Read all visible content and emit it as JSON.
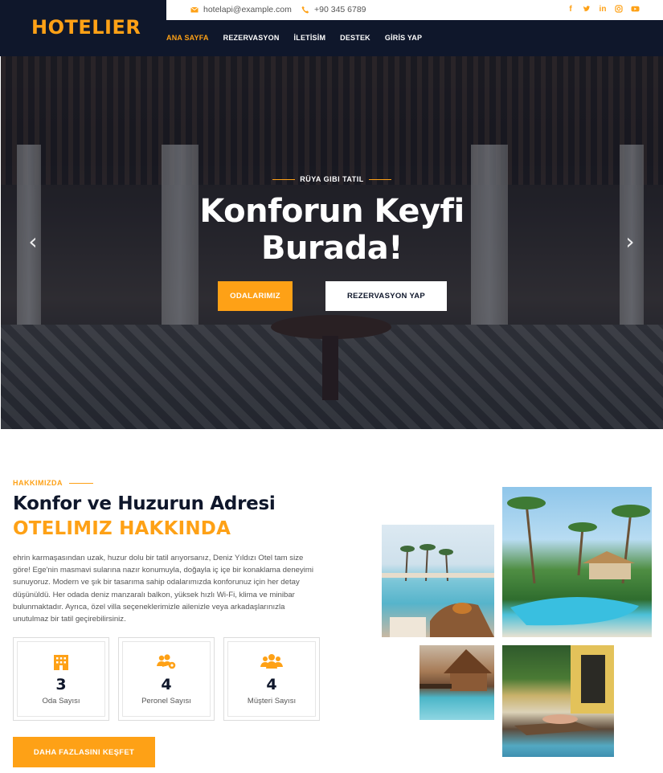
{
  "brand": {
    "logo": "HOTELIER",
    "accent": "#fea116",
    "dark": "#0f172b"
  },
  "topbar": {
    "email": "hotelapi@example.com",
    "phone": "+90 345 6789",
    "socials": [
      "facebook-icon",
      "twitter-icon",
      "linkedin-icon",
      "instagram-icon",
      "youtube-icon"
    ]
  },
  "nav": {
    "items": [
      "ANA SAYFA",
      "REZERVASYON",
      "İLETİSİM",
      "DESTEK",
      "GİRİS YAP"
    ]
  },
  "hero": {
    "kicker": "RÜYA GIBI TATIL",
    "title_line1": "Konforun Keyfi",
    "title_line2": "Burada!",
    "btn_rooms": "ODALARIMIZ",
    "btn_book": "REZERVASYON YAP"
  },
  "about": {
    "kicker": "HAKKIMIZDA",
    "title": "Konfor ve Huzurun Adresi",
    "title2": "OTELIMIZ HAKKINDA",
    "text": "ehrin karmaşasından uzak, huzur dolu bir tatil arıyorsanız, Deniz Yıldızı Otel tam size göre! Ege'nin masmavi sularına nazır konumuyla, doğayla iç içe bir konaklama deneyimi sunuyoruz. Modern ve şık bir tasarıma sahip odalarımızda konforunuz için her detay düşünüldü. Her odada deniz manzaralı balkon, yüksek hızlı Wi-Fi, klima ve minibar bulunmaktadır. Ayrıca, özel villa seçeneklerimizle ailenizle veya arkadaşlarınızla unutulmaz bir tatil geçirebilirsiniz.",
    "stats": [
      {
        "value": "3",
        "label": "Oda Sayısı",
        "icon": "hotel-icon"
      },
      {
        "value": "4",
        "label": "Peronel Sayısı",
        "icon": "users-gear-icon"
      },
      {
        "value": "4",
        "label": "Müşteri Sayısı",
        "icon": "users-icon"
      }
    ],
    "cta": "DAHA FAZLASINI KEŞFET"
  }
}
